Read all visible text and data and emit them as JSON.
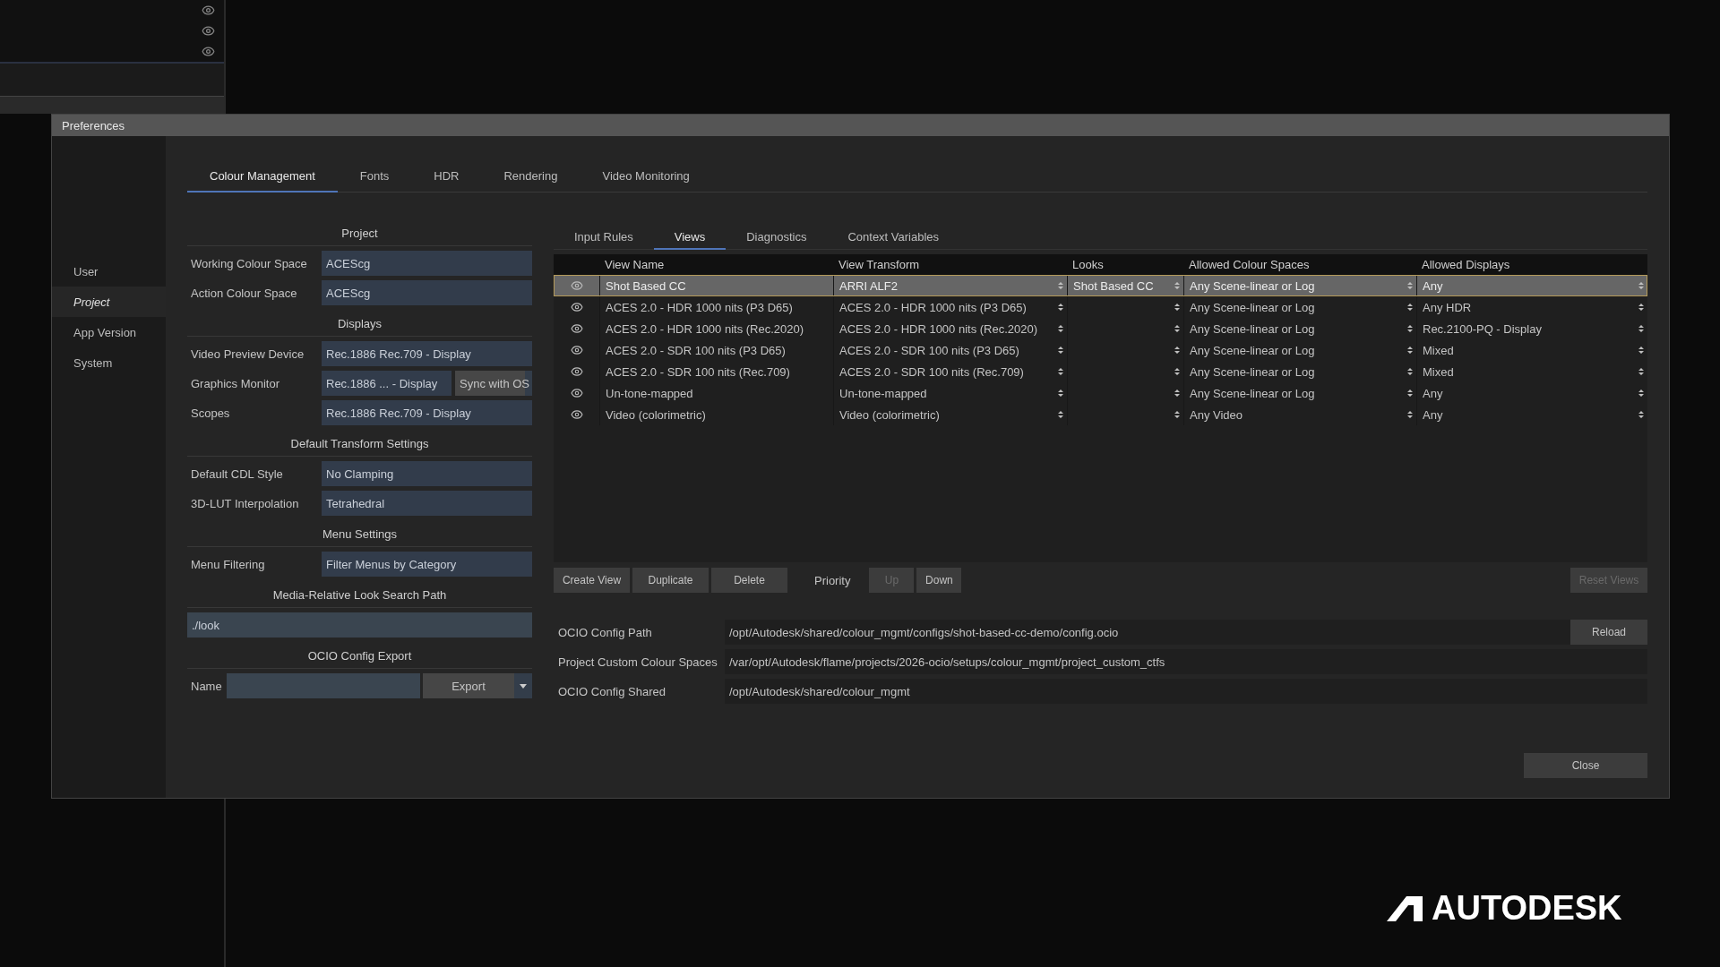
{
  "window": {
    "title": "Preferences"
  },
  "sidebar": {
    "items": [
      {
        "label": "User",
        "selected": false
      },
      {
        "label": "Project",
        "selected": true
      },
      {
        "label": "App Version",
        "selected": false
      },
      {
        "label": "System",
        "selected": false
      }
    ]
  },
  "tabs": [
    {
      "label": "Colour Management",
      "selected": true
    },
    {
      "label": "Fonts",
      "selected": false
    },
    {
      "label": "HDR",
      "selected": false
    },
    {
      "label": "Rendering",
      "selected": false
    },
    {
      "label": "Video Monitoring",
      "selected": false
    }
  ],
  "project_panel": {
    "sections": [
      {
        "heading": "Project",
        "items": [
          {
            "kind": "select",
            "label": "Working Colour Space",
            "value": "ACEScg"
          },
          {
            "kind": "select",
            "label": "Action Colour Space",
            "value": "ACEScg"
          }
        ]
      },
      {
        "heading": "Displays",
        "items": [
          {
            "kind": "select",
            "label": "Video Preview Device",
            "value": "Rec.1886 Rec.709 - Display"
          },
          {
            "kind": "pair",
            "label": "Graphics Monitor",
            "value": "Rec.1886 ... - Display",
            "option": "Sync with OS"
          },
          {
            "kind": "select",
            "label": "Scopes",
            "value": "Rec.1886 Rec.709 - Display"
          }
        ]
      },
      {
        "heading": "Default Transform Settings",
        "items": [
          {
            "kind": "select",
            "label": "Default CDL Style",
            "value": "No Clamping"
          },
          {
            "kind": "select",
            "label": "3D-LUT Interpolation",
            "value": "Tetrahedral"
          }
        ]
      },
      {
        "heading": "Menu Settings",
        "items": [
          {
            "kind": "select",
            "label": "Menu Filtering",
            "value": "Filter Menus by Category"
          }
        ]
      },
      {
        "heading": "Media-Relative Look Search Path",
        "items": [
          {
            "kind": "path",
            "value": "./look"
          }
        ]
      },
      {
        "heading": "OCIO Config Export",
        "items": [
          {
            "kind": "export",
            "label": "Name",
            "button": "Export"
          }
        ]
      }
    ]
  },
  "sub_tabs": [
    {
      "label": "Input Rules",
      "selected": false
    },
    {
      "label": "Views",
      "selected": true
    },
    {
      "label": "Diagnostics",
      "selected": false
    },
    {
      "label": "Context Variables",
      "selected": false
    }
  ],
  "views_table": {
    "columns": [
      "View Name",
      "View Transform",
      "Looks",
      "Allowed Colour Spaces",
      "Allowed Displays"
    ],
    "rows": [
      {
        "visible": true,
        "selected": true,
        "view_name": "Shot Based CC",
        "view_transform": "ARRI ALF2",
        "looks": "Shot Based CC",
        "allowed_colour_spaces": "Any Scene-linear or Log",
        "allowed_displays": "Any"
      },
      {
        "visible": true,
        "selected": false,
        "view_name": "ACES 2.0 - HDR 1000 nits (P3 D65)",
        "view_transform": "ACES 2.0 - HDR 1000 nits (P3 D65)",
        "allowed_colour_spaces": "Any Scene-linear or Log",
        "allowed_displays": "Any HDR"
      },
      {
        "visible": true,
        "selected": false,
        "view_name": "ACES 2.0 - HDR 1000 nits (Rec.2020)",
        "view_transform": "ACES 2.0 - HDR 1000 nits (Rec.2020)",
        "allowed_colour_spaces": "Any Scene-linear or Log",
        "allowed_displays": "Rec.2100-PQ - Display"
      },
      {
        "visible": true,
        "selected": false,
        "view_name": "ACES 2.0 - SDR 100 nits (P3 D65)",
        "view_transform": "ACES 2.0 - SDR 100 nits (P3 D65)",
        "allowed_colour_spaces": "Any Scene-linear or Log",
        "allowed_displays": "Mixed"
      },
      {
        "visible": true,
        "selected": false,
        "view_name": "ACES 2.0 - SDR 100 nits (Rec.709)",
        "view_transform": "ACES 2.0 - SDR 100 nits (Rec.709)",
        "allowed_colour_spaces": "Any Scene-linear or Log",
        "allowed_displays": "Mixed"
      },
      {
        "visible": true,
        "selected": false,
        "view_name": "Un-tone-mapped",
        "view_transform": "Un-tone-mapped",
        "allowed_colour_spaces": "Any Scene-linear or Log",
        "allowed_displays": "Any"
      },
      {
        "visible": true,
        "selected": false,
        "view_name": "Video (colorimetric)",
        "view_transform": "Video (colorimetric)",
        "allowed_colour_spaces": "Any Video",
        "allowed_displays": "Any"
      }
    ]
  },
  "view_buttons": [
    {
      "label": "Create View",
      "disabled": false
    },
    {
      "label": "Duplicate",
      "disabled": false
    },
    {
      "label": "Delete",
      "disabled": false
    }
  ],
  "priority": {
    "label": "Priority",
    "buttons": [
      {
        "label": "Up",
        "disabled": true
      },
      {
        "label": "Down",
        "disabled": false
      }
    ]
  },
  "reset_button": {
    "label": "Reset Views",
    "disabled": true
  },
  "config_paths": [
    {
      "label": "OCIO Config Path",
      "value": "/opt/Autodesk/shared/colour_mgmt/configs/shot-based-cc-demo/config.ocio",
      "button": "Reload"
    },
    {
      "label": "Project Custom Colour Spaces",
      "value": "/var/opt/Autodesk/flame/projects/2026-ocio/setups/colour_mgmt/project_custom_ctfs"
    },
    {
      "label": "OCIO Config Shared",
      "value": "/opt/Autodesk/shared/colour_mgmt"
    }
  ],
  "close_button": "Close",
  "brand_logo": {
    "text": "AUTODESK"
  }
}
